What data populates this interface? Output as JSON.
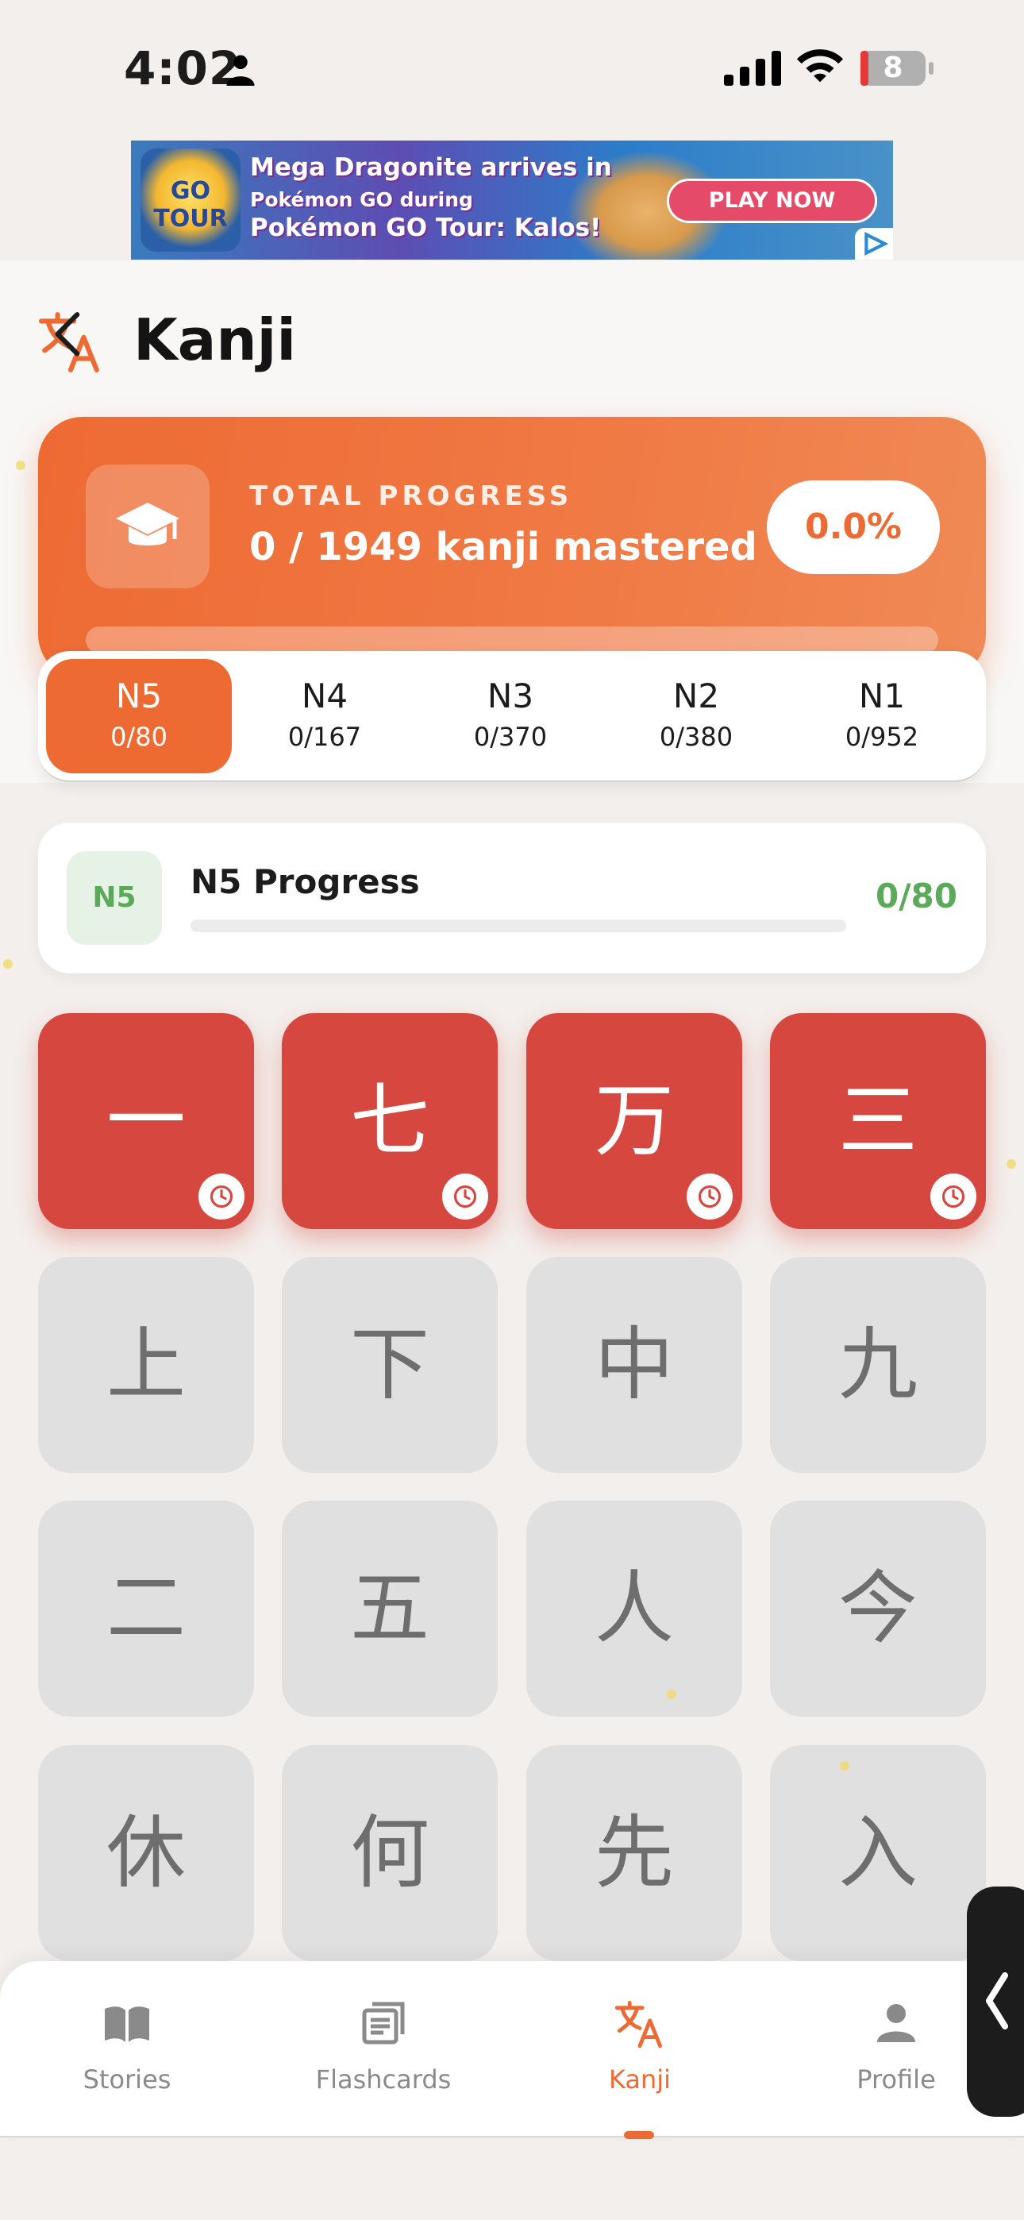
{
  "status_bar": {
    "time": "4:02",
    "battery": "8"
  },
  "ad": {
    "logo_text": "GO TOUR",
    "line1": "Mega Dragonite arrives in",
    "line2": "Pokémon GO during",
    "line3": "Pokémon GO Tour: Kalos!",
    "cta": "PLAY NOW"
  },
  "header": {
    "title": "Kanji",
    "icon": "translate-icon"
  },
  "total_progress": {
    "label": "TOTAL PROGRESS",
    "value": "0 / 1949 kanji mastered",
    "percent": "0.0%",
    "fraction": 0.0,
    "icon": "graduation-cap-icon"
  },
  "levels": [
    {
      "name": "N5",
      "count": "0/80",
      "active": true
    },
    {
      "name": "N4",
      "count": "0/167",
      "active": false
    },
    {
      "name": "N3",
      "count": "0/370",
      "active": false
    },
    {
      "name": "N2",
      "count": "0/380",
      "active": false
    },
    {
      "name": "N1",
      "count": "0/952",
      "active": false
    }
  ],
  "level_progress": {
    "badge": "N5",
    "title": "N5 Progress",
    "count": "0/80",
    "fraction": 0.0
  },
  "kanji": [
    {
      "char": "一",
      "state": "learning"
    },
    {
      "char": "七",
      "state": "learning"
    },
    {
      "char": "万",
      "state": "learning"
    },
    {
      "char": "三",
      "state": "learning"
    },
    {
      "char": "上",
      "state": "locked"
    },
    {
      "char": "下",
      "state": "locked"
    },
    {
      "char": "中",
      "state": "locked"
    },
    {
      "char": "九",
      "state": "locked"
    },
    {
      "char": "二",
      "state": "locked"
    },
    {
      "char": "五",
      "state": "locked"
    },
    {
      "char": "人",
      "state": "locked"
    },
    {
      "char": "今",
      "state": "locked"
    },
    {
      "char": "休",
      "state": "locked"
    },
    {
      "char": "何",
      "state": "locked"
    },
    {
      "char": "先",
      "state": "locked"
    },
    {
      "char": "入",
      "state": "locked"
    }
  ],
  "nav": [
    {
      "label": "Stories",
      "icon": "book-icon",
      "active": false
    },
    {
      "label": "Flashcards",
      "icon": "cards-icon",
      "active": false
    },
    {
      "label": "Kanji",
      "icon": "translate-icon",
      "active": true
    },
    {
      "label": "Profile",
      "icon": "person-icon",
      "active": false
    }
  ],
  "colors": {
    "accent": "#ee6a33",
    "learning": "#d6473f",
    "success": "#5aaa5a",
    "locked": "#e0e0e0"
  }
}
